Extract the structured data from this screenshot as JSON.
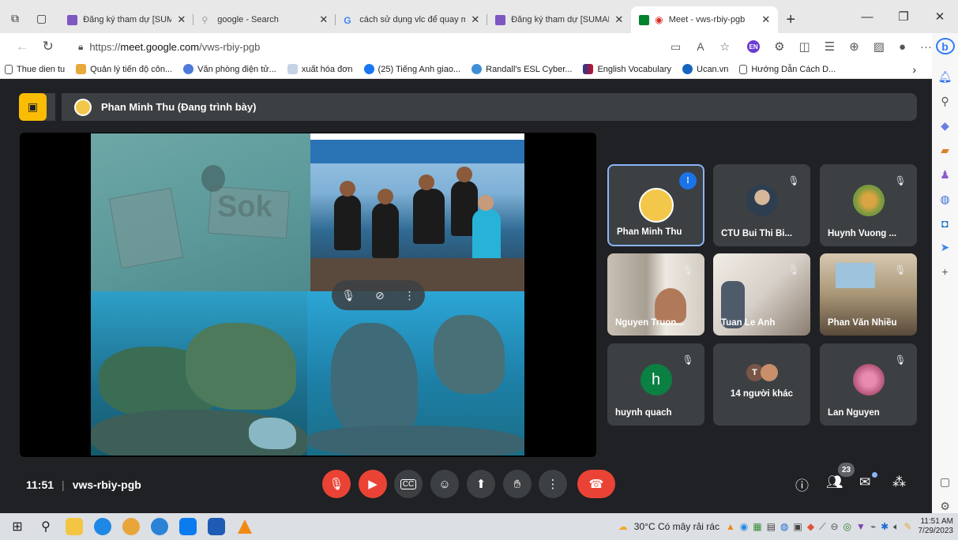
{
  "browser": {
    "tabs": [
      {
        "label": "Đăng ký tham dự [SUMARE",
        "color": "#7e57c2",
        "active": false
      },
      {
        "label": "google - Search",
        "color": "#b0b0b0",
        "active": false
      },
      {
        "label": "cách sử dụng vlc để quay m",
        "color": "#4285f4",
        "active": false
      },
      {
        "label": "Đăng ký tham dự [SUMARE",
        "color": "#7e57c2",
        "active": false
      },
      {
        "label": "Meet - vws-rbiy-pgb",
        "color": "#00832d",
        "active": true
      }
    ],
    "new_tab": "+",
    "window_controls": [
      "—",
      "❐",
      "✕"
    ],
    "url_scheme": "https://",
    "url_host": "meet.google.com",
    "url_path": "/vws-rbiy-pgb",
    "extension_badge": "EN",
    "more": "···",
    "bing": "b"
  },
  "bookmarks": [
    {
      "label": "Thue dien tu",
      "color": "#555555"
    },
    {
      "label": "Quản lý tiến độ côn...",
      "color": "#e8a93b"
    },
    {
      "label": "Văn phòng điện tử...",
      "color": "#4c7bd9"
    },
    {
      "label": "xuất hóa đơn",
      "color": "#c5d3e6"
    },
    {
      "label": "(25) Tiếng Anh giao...",
      "color": "#1877f2"
    },
    {
      "label": "Randall's ESL Cyber...",
      "color": "#3f8fd6"
    },
    {
      "label": "English Vocabulary",
      "color": "#c8102e"
    },
    {
      "label": "Ucan.vn",
      "color": "#1565c0"
    },
    {
      "label": "Hướng Dẫn Cách D...",
      "color": "#555555"
    }
  ],
  "meet": {
    "presenter_banner": "Phan Minh Thu (Đang trình bày)",
    "slide_text": "Sok",
    "tiles": [
      {
        "name": "Phan Minh Thu",
        "speaking": true,
        "muted": false
      },
      {
        "name": "CTU Bui Thi Bi...",
        "speaking": false,
        "muted": true
      },
      {
        "name": "Huynh Vuong ...",
        "speaking": false,
        "muted": true
      },
      {
        "name": "Nguyen Truon...",
        "speaking": false,
        "muted": true
      },
      {
        "name": "Tuan Le Anh",
        "speaking": false,
        "muted": true
      },
      {
        "name": "Phan Văn Nhiều",
        "speaking": false,
        "muted": true
      },
      {
        "name": "huynh quach",
        "speaking": false,
        "muted": true,
        "initial": "h"
      },
      {
        "name": "14 người khác",
        "speaking": false,
        "muted": false,
        "initial": "T"
      },
      {
        "name": "Lan Nguyen",
        "speaking": false,
        "muted": true
      }
    ],
    "time": "11:51",
    "separator": "|",
    "code": "vws-rbiy-pgb",
    "participant_count": "23"
  },
  "taskbar": {
    "weather": "30°C  Có mây rải rác",
    "time": "11:51 AM",
    "date": "7/29/2023"
  },
  "colors": {
    "meet_bg": "#202124",
    "tile_bg": "#3c4043",
    "danger": "#ea4335",
    "present_button": "#fbbc04",
    "speaking_border": "#8ab4f8"
  }
}
